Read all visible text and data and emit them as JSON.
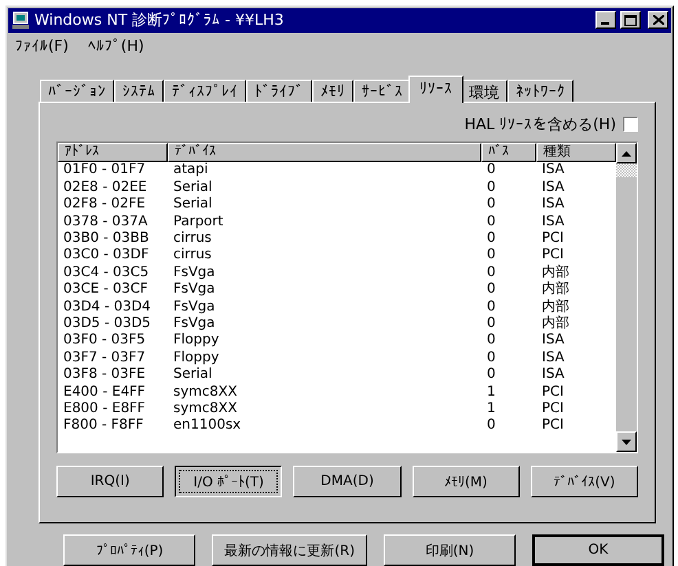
{
  "window": {
    "title": "Windows NT 診断ﾌﾟﾛｸﾞﾗﾑ - ¥¥LH3"
  },
  "menu": [
    "ﾌｧｲﾙ(F)",
    "ﾍﾙﾌﾟ(H)"
  ],
  "tabs": [
    {
      "label": "ﾊﾞｰｼﾞｮﾝ",
      "selected": false
    },
    {
      "label": "ｼｽﾃﾑ",
      "selected": false
    },
    {
      "label": "ﾃﾞｨｽﾌﾟﾚｲ",
      "selected": false
    },
    {
      "label": "ﾄﾞﾗｲﾌﾞ",
      "selected": false
    },
    {
      "label": "ﾒﾓﾘ",
      "selected": false
    },
    {
      "label": "ｻｰﾋﾞｽ",
      "selected": false
    },
    {
      "label": "ﾘｿｰｽ",
      "selected": true
    },
    {
      "label": "環境",
      "selected": false
    },
    {
      "label": "ﾈｯﾄﾜｰｸ",
      "selected": false
    }
  ],
  "hal_checkbox": {
    "label": "HAL ﾘｿｰｽを含める(H)",
    "checked": false
  },
  "table": {
    "columns": [
      "ｱﾄﾞﾚｽ",
      "ﾃﾞﾊﾞｲｽ",
      "ﾊﾞｽ",
      "種類"
    ],
    "rows": [
      [
        "01F0 - 01F7",
        "atapi",
        "0",
        "ISA"
      ],
      [
        "02E8 - 02EE",
        "Serial",
        "0",
        "ISA"
      ],
      [
        "02F8 - 02FE",
        "Serial",
        "0",
        "ISA"
      ],
      [
        "0378 - 037A",
        "Parport",
        "0",
        "ISA"
      ],
      [
        "03B0 - 03BB",
        "cirrus",
        "0",
        "PCI"
      ],
      [
        "03C0 - 03DF",
        "cirrus",
        "0",
        "PCI"
      ],
      [
        "03C4 - 03C5",
        "FsVga",
        "0",
        "内部"
      ],
      [
        "03CE - 03CF",
        "FsVga",
        "0",
        "内部"
      ],
      [
        "03D4 - 03D4",
        "FsVga",
        "0",
        "内部"
      ],
      [
        "03D5 - 03D5",
        "FsVga",
        "0",
        "内部"
      ],
      [
        "03F0 - 03F5",
        "Floppy",
        "0",
        "ISA"
      ],
      [
        "03F7 - 03F7",
        "Floppy",
        "0",
        "ISA"
      ],
      [
        "03F8 - 03FE",
        "Serial",
        "0",
        "ISA"
      ],
      [
        "E400 - E4FF",
        "symc8XX",
        "1",
        "PCI"
      ],
      [
        "E800 - E8FF",
        "symc8XX",
        "1",
        "PCI"
      ],
      [
        "F800 - F8FF",
        "en1100sx",
        "0",
        "PCI"
      ]
    ]
  },
  "resource_buttons": [
    {
      "label": "IRQ(I)",
      "selected": false
    },
    {
      "label": "I/O ﾎﾟｰﾄ(T)",
      "selected": true
    },
    {
      "label": "DMA(D)",
      "selected": false
    },
    {
      "label": "ﾒﾓﾘ(M)",
      "selected": false
    },
    {
      "label": "ﾃﾞﾊﾞｲｽ(V)",
      "selected": false
    }
  ],
  "buttons": [
    "ﾌﾟﾛﾊﾟﾃｨ(P)",
    "最新の情報に更新(R)",
    "印刷(N)",
    "OK"
  ]
}
